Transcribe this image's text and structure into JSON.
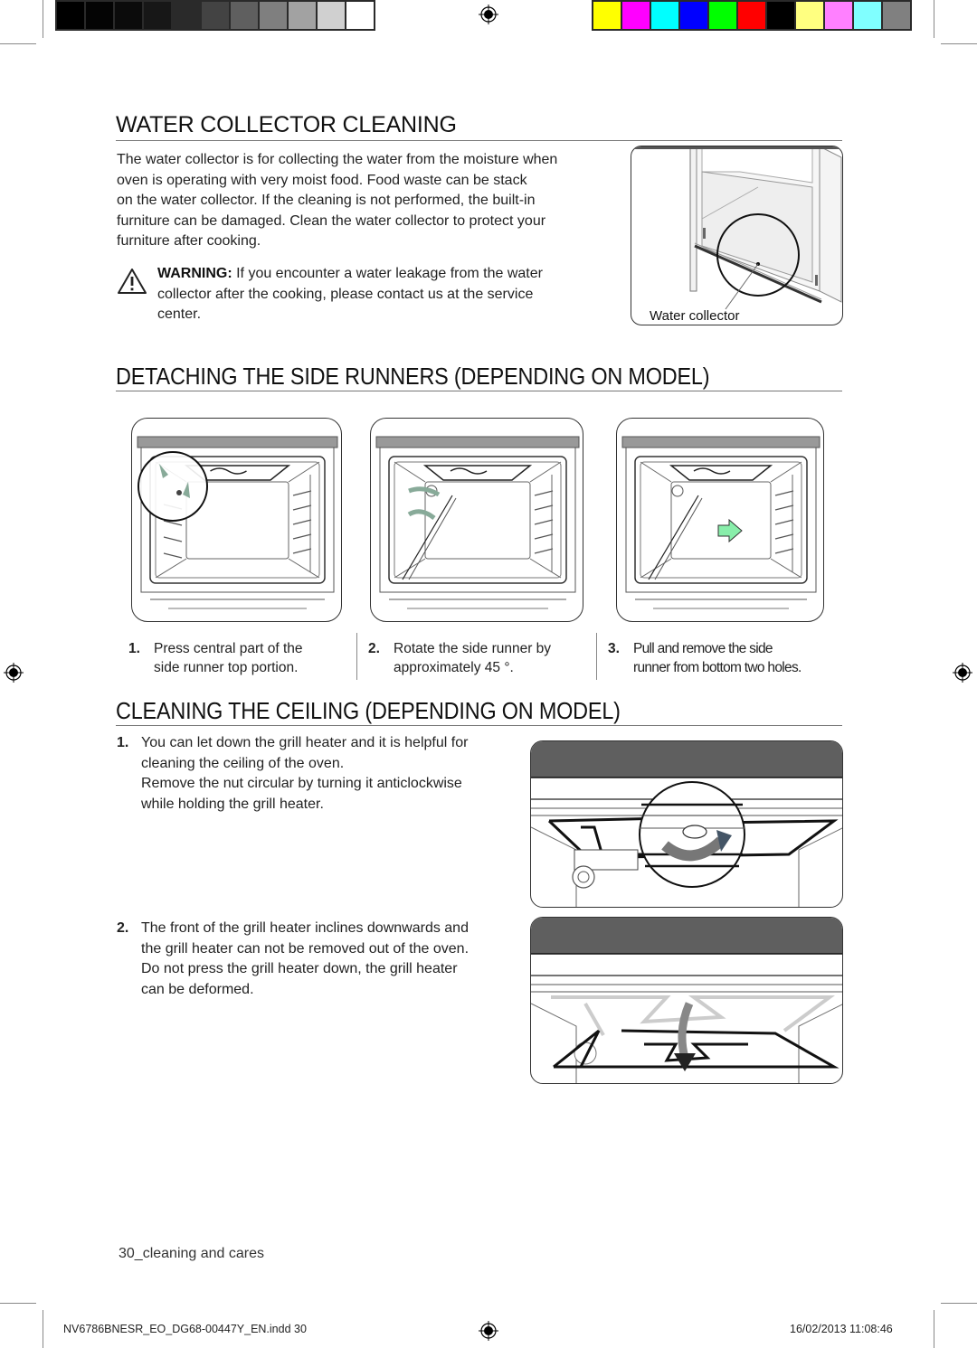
{
  "print_marks": {
    "grayscale_swatches": [
      "#000000",
      "#040404",
      "#0b0b0b",
      "#171717",
      "#2a2a2a",
      "#434343",
      "#5f5f5f",
      "#7f7f7f",
      "#a2a2a2",
      "#d0d0d0",
      "#ffffff"
    ],
    "color_swatches": [
      "#ffff00",
      "#ff00ff",
      "#00ffff",
      "#0000ff",
      "#00ff00",
      "#ff0000",
      "#000000",
      "#ffff80",
      "#ff80ff",
      "#80ffff",
      "#808080"
    ]
  },
  "sections": {
    "water_collector": {
      "title": "WATER COLLECTOR CLEANING",
      "body_lines": [
        "The water collector is for collecting the water from the moisture when",
        "oven is operating with very moist food. Food waste can be stack",
        "on the water collector. If the cleaning is not performed, the built-in",
        "furniture can be damaged. Clean the water collector to protect your",
        "furniture after cooking."
      ],
      "warning_label": "WARNING:",
      "warning_lines": [
        " If you encounter a water leakage from the water",
        "collector after the cooking, please contact us at the service",
        "center."
      ],
      "figure_caption": "Water collector",
      "warning_icon": "warning-triangle-icon"
    },
    "side_runners": {
      "title": "DETACHING THE SIDE RUNNERS (DEPENDING ON MODEL)",
      "steps": [
        {
          "num": "1.",
          "lines": [
            "Press central part of the",
            "side runner top portion."
          ]
        },
        {
          "num": "2.",
          "lines": [
            "Rotate the side runner by",
            "approximately 45 °."
          ]
        },
        {
          "num": "3.",
          "lines": [
            "Pull and remove the side",
            "runner from bottom two holes."
          ]
        }
      ]
    },
    "ceiling": {
      "title": "CLEANING THE CEILING (DEPENDING ON MODEL)",
      "items": [
        {
          "num": "1.",
          "lines": [
            "You can let down the grill heater and it is helpful for",
            "cleaning the ceiling of the oven.",
            "Remove the nut circular by turning it anticlockwise",
            "while holding the grill heater."
          ]
        },
        {
          "num": "2.",
          "lines": [
            "The front of the grill heater inclines downwards and",
            "the grill heater can not be removed out of the oven.",
            "Do not press the grill heater down, the grill heater",
            "can be deformed."
          ]
        }
      ]
    }
  },
  "footer": {
    "page_label": "30_cleaning and cares",
    "file_slug": "NV6786BNESR_EO_DG68-00447Y_EN.indd   30",
    "timestamp": "16/02/2013   11:08:46"
  }
}
